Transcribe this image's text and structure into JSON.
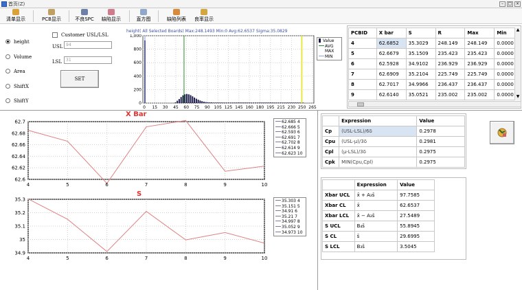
{
  "window": {
    "title": "首页(Z)"
  },
  "toolbar": {
    "items": [
      {
        "label": "清单显示",
        "color": "#d9a33a"
      },
      {
        "label": "PCB显示",
        "color": "#c0a060"
      },
      {
        "label": "不良SPC",
        "color": "#6d7fa8"
      },
      {
        "label": "缺陷显示",
        "color": "#d07a8a"
      },
      {
        "label": "直方图",
        "color": "#8fa7c8"
      },
      {
        "label": "缺陷列表",
        "color": "#d88a3a"
      },
      {
        "label": "良率显示",
        "color": "#d4a640"
      }
    ]
  },
  "controls": {
    "radios": [
      "height",
      "Volume",
      "Area",
      "ShiftX",
      "ShiftY"
    ],
    "selected": "height",
    "customer_label": "Customer USL/LSL",
    "usl_label": "USL",
    "usl_value": "94",
    "lsl_label": "LSL",
    "lsl_value": "31",
    "set_label": "SET"
  },
  "histogram": {
    "title": "height( All Selected Boards)  Max:248.1493  Min:0  Avg:62.6537  Sigma:35.0829",
    "y_ticks": [
      "1,000",
      "800",
      "600",
      "400",
      "200",
      "0"
    ],
    "x_ticks": [
      "0",
      "15",
      "30",
      "45",
      "60",
      "75",
      "90",
      "105",
      "125",
      "145",
      "160",
      "180",
      "195",
      "215",
      "230",
      "250",
      "265"
    ],
    "legend": [
      "Value",
      "AVG",
      "MAX",
      "MIN"
    ],
    "colors": {
      "value": "#1a1a4a",
      "avg": "#2e8b2e",
      "max": "#e8e840",
      "min": "#8aa0d8"
    },
    "chart_data": {
      "type": "bar",
      "title": "height( All Selected Boards)  Max:248.1493  Min:0  Avg:62.6537  Sigma:35.0829",
      "categories": [
        0,
        3,
        6,
        9,
        12,
        48,
        51,
        54,
        57,
        60,
        63,
        66,
        69,
        72,
        75,
        78,
        81,
        84,
        87,
        90,
        93,
        96,
        99,
        102,
        105,
        108,
        111,
        114,
        117,
        120,
        123,
        126,
        129,
        132,
        135,
        138,
        141,
        144,
        147,
        150,
        153,
        156,
        159,
        162,
        165,
        168,
        171,
        174,
        177,
        180,
        183,
        186,
        189,
        192,
        195,
        198,
        201,
        204,
        207,
        210,
        213,
        216,
        219,
        222,
        225,
        228,
        231,
        234,
        237,
        240,
        243,
        246,
        249
      ],
      "values": [
        930,
        0,
        0,
        0,
        0,
        10,
        35,
        60,
        90,
        115,
        130,
        135,
        130,
        118,
        100,
        82,
        65,
        50,
        38,
        28,
        20,
        15,
        12,
        10,
        10,
        8,
        8,
        8,
        8,
        8,
        8,
        8,
        8,
        8,
        8,
        8,
        8,
        8,
        8,
        8,
        8,
        8,
        8,
        8,
        8,
        8,
        8,
        8,
        8,
        8,
        8,
        8,
        8,
        8,
        8,
        8,
        8,
        8,
        8,
        8,
        8,
        8,
        8,
        8,
        8,
        8,
        8,
        8,
        8,
        8,
        8,
        8,
        8
      ],
      "ylim": [
        0,
        1000
      ],
      "xlim": [
        0,
        265
      ],
      "avg": 62.6537,
      "max": 248.1493,
      "min": 0,
      "grid": true,
      "legend_position": "right"
    }
  },
  "pcb_table": {
    "headers": [
      "PCBID",
      "X bar",
      "S",
      "R",
      "Max",
      "Min"
    ],
    "rows": [
      [
        "4",
        "62.6852",
        "35.3029",
        "248.149",
        "248.149",
        "0.0000"
      ],
      [
        "5",
        "62.6679",
        "35.1509",
        "235.423",
        "235.423",
        "0.0000"
      ],
      [
        "6",
        "62.5928",
        "34.9102",
        "236.929",
        "236.929",
        "0.0000"
      ],
      [
        "7",
        "62.6909",
        "35.2104",
        "225.749",
        "225.749",
        "0.0000"
      ],
      [
        "8",
        "62.7017",
        "34.9966",
        "236.437",
        "236.437",
        "0.0000"
      ],
      [
        "9",
        "62.6140",
        "35.0521",
        "235.002",
        "235.002",
        "0.0000"
      ]
    ]
  },
  "xbar_chart": {
    "title": "X Bar",
    "y_ticks": [
      "62.7",
      "62.68",
      "62.66",
      "62.64",
      "62.62",
      "62.6"
    ],
    "x_ticks": [
      "4",
      "5",
      "6",
      "7",
      "8",
      "9",
      "10"
    ],
    "legend": [
      "62.685 4",
      "62.666 5",
      "62.593 6",
      "62.691 7",
      "62.702 8",
      "62.614 9",
      "62.623 10"
    ],
    "colors": {
      "line": "#e08080",
      "title": "#e03030"
    },
    "chart_data": {
      "type": "line",
      "title": "X Bar",
      "x": [
        4,
        5,
        6,
        7,
        8,
        9,
        10
      ],
      "series": [
        {
          "values": [
            62.685,
            62.666,
            62.593,
            62.691,
            62.702,
            62.614,
            62.623
          ]
        }
      ],
      "ylim": [
        62.6,
        62.7
      ],
      "xlim": [
        4,
        10
      ],
      "grid": true,
      "legend_position": "right"
    }
  },
  "s_chart": {
    "title": "S",
    "y_ticks": [
      "35.3",
      "35.2",
      "35.1",
      "35",
      "34.9"
    ],
    "x_ticks": [
      "4",
      "5",
      "6",
      "7",
      "8",
      "9",
      "10"
    ],
    "legend": [
      "35.303 4",
      "35.151 5",
      "34.91 6",
      "35.21 7",
      "34.997 8",
      "35.052 9",
      "34.973 10"
    ],
    "colors": {
      "line": "#e08080",
      "title": "#e03030"
    },
    "chart_data": {
      "type": "line",
      "title": "S",
      "x": [
        4,
        5,
        6,
        7,
        8,
        9,
        10
      ],
      "series": [
        {
          "values": [
            35.303,
            35.151,
            34.91,
            35.21,
            34.997,
            35.052,
            34.973
          ]
        }
      ],
      "ylim": [
        34.9,
        35.3
      ],
      "xlim": [
        4,
        10
      ],
      "grid": true,
      "legend_position": "right"
    }
  },
  "cp_table": {
    "headers": [
      "",
      "Expression",
      "Value"
    ],
    "rows": [
      [
        "Cp",
        "(USL-LSL)/6δ",
        "0.2978"
      ],
      [
        "Cpu",
        "(USL-μ)/3δ",
        "0.2981"
      ],
      [
        "Cpl",
        "(μ-LSL)/3δ",
        "0.2975"
      ],
      [
        "Cpk",
        "MIN(Cpu,Cpl)",
        "0.2975"
      ]
    ]
  },
  "ucl_table": {
    "headers": [
      "",
      "Expression",
      "Value"
    ],
    "rows": [
      [
        "Xbar UCL",
        "x̄ + A₃s̄",
        "97.7585"
      ],
      [
        "Xbar CL",
        "x̄",
        "62.6537"
      ],
      [
        "Xbar LCL",
        "x̄ − A₃s̄",
        "27.5489"
      ],
      [
        "S UCL",
        "B₄s̄",
        "55.8945"
      ],
      [
        "S CL",
        "s̄",
        "29.6995"
      ],
      [
        "S LCL",
        "B₃s̄",
        "3.5045"
      ]
    ]
  }
}
